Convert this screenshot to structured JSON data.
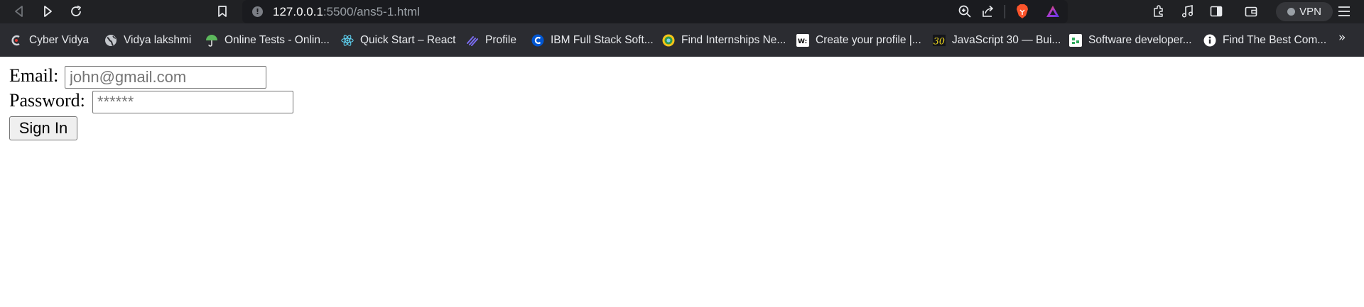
{
  "browser": {
    "url_host": "127.0.0.1",
    "url_rest": ":5500/ans5-1.html",
    "vpn_label": "VPN",
    "bookmarks_more": "»",
    "bookmarks": [
      {
        "label": "Cyber Vidya",
        "icon": "cyber-vidya-icon"
      },
      {
        "label": "Vidya lakshmi",
        "icon": "globe-icon"
      },
      {
        "label": "Online Tests - Onlin...",
        "icon": "umbrella-icon"
      },
      {
        "label": "Quick Start – React",
        "icon": "react-icon"
      },
      {
        "label": "Profile",
        "icon": "profile-icon"
      },
      {
        "label": "IBM Full Stack Soft...",
        "icon": "coursera-icon"
      },
      {
        "label": "Find Internships Ne...",
        "icon": "internshala-icon"
      },
      {
        "label": "Create your profile |...",
        "icon": "wellfound-icon"
      },
      {
        "label": "JavaScript 30 — Bui...",
        "icon": "js30-icon"
      },
      {
        "label": "Software developer...",
        "icon": "naukri-icon"
      },
      {
        "label": "Find The Best Com...",
        "icon": "info-icon"
      }
    ]
  },
  "form": {
    "email_label": "Email:",
    "email_placeholder": "john@gmail.com",
    "password_label": "Password:",
    "password_placeholder": "******",
    "submit_label": "Sign In"
  },
  "colors": {
    "toolbar_bg": "#202124",
    "urlbar_bg": "#1a1b1f",
    "bookmarks_bg": "#2b2c31",
    "brave_orange": "#fb542b",
    "page_bg": "#ffffff"
  }
}
